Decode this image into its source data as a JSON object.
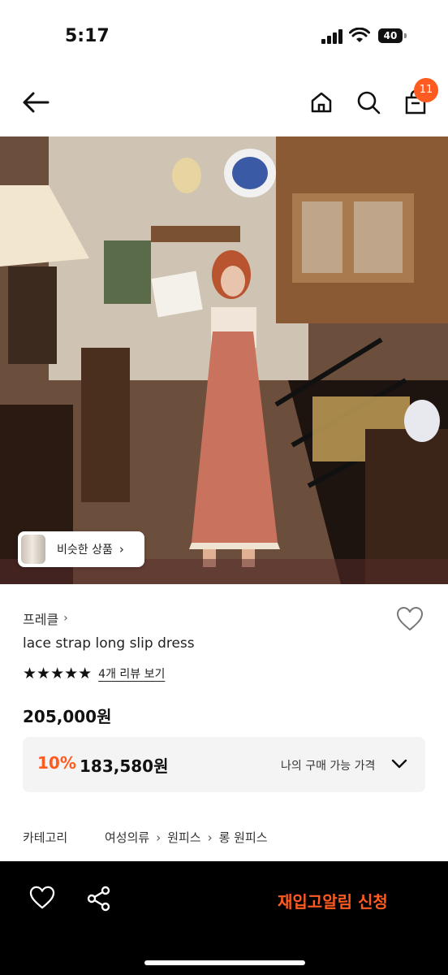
{
  "status_bar": {
    "time": "5:17",
    "battery": "40"
  },
  "nav": {
    "cart_count": "11"
  },
  "hero": {
    "similar_label": "비슷한 상품"
  },
  "product": {
    "brand": "프레클",
    "name": "lace strap long slip dress",
    "rating_stars": "★★★★★",
    "review_link": "4개 리뷰 보기",
    "price": "205,000원",
    "discount_rate": "10%",
    "discount_price": "183,580원",
    "my_price_label": "나의 구매 가능 가격"
  },
  "category": {
    "label": "카테고리",
    "path": [
      "여성의류",
      "원피스",
      "롱 원피스"
    ]
  },
  "bottom_bar": {
    "restock_label": "재입고알림 신청"
  },
  "colors": {
    "accent": "#ff5a1f",
    "bottom_bar": "#000000"
  },
  "icons": [
    "back-arrow-icon",
    "home-icon",
    "search-icon",
    "shopping-bag-icon",
    "heart-icon",
    "share-icon",
    "chevron-down-icon"
  ]
}
